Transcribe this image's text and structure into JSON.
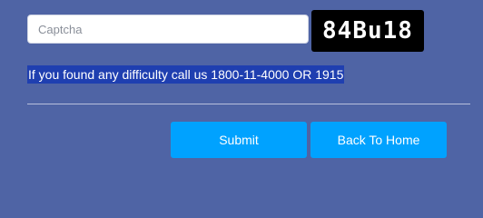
{
  "captcha": {
    "placeholder": "Captcha",
    "value": "",
    "image_text": "84Bu18"
  },
  "help": {
    "text": "If you found any difficulty call us 1800-11-4000 OR 1915"
  },
  "actions": {
    "submit_label": "Submit",
    "home_label": "Back To Home"
  },
  "colors": {
    "background": "#4f64a5",
    "button": "#00a2ff",
    "highlight": "#1f3fb0",
    "captcha_bg": "#000000"
  }
}
